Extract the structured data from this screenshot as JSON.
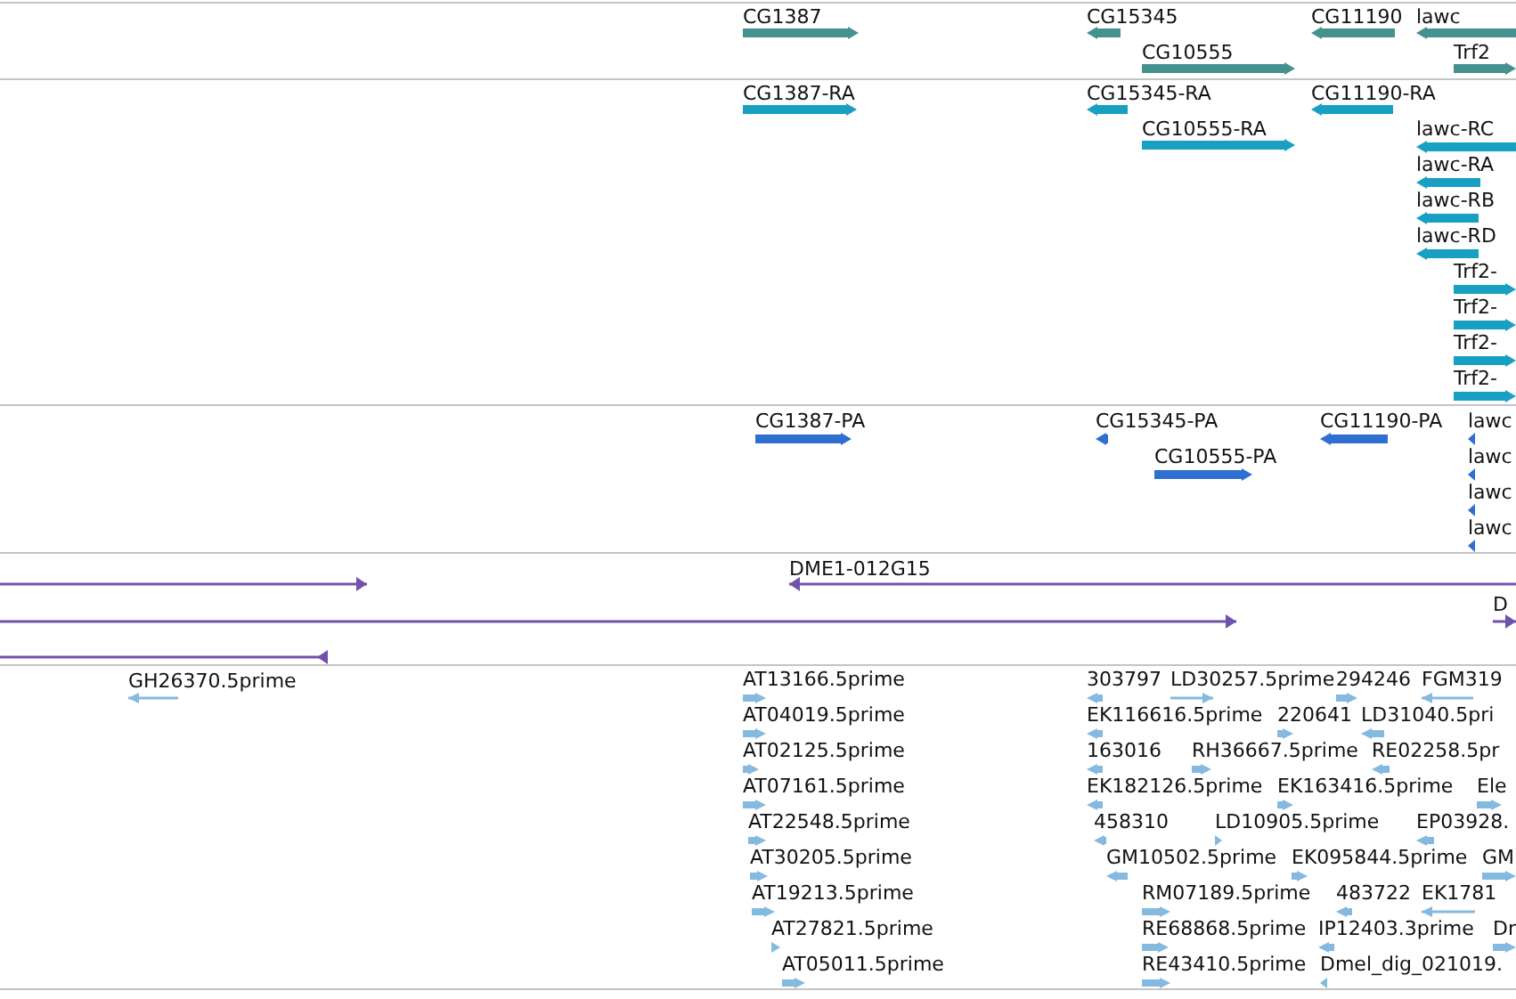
{
  "tracks": [
    {
      "kind": "gene",
      "features": [
        {
          "label": "CG1387",
          "reverse": false
        },
        {
          "label": "CG15345",
          "reverse": true
        },
        {
          "label": "CG10555",
          "reverse": false
        },
        {
          "label": "CG11190",
          "reverse": true
        },
        {
          "label": "lawc",
          "reverse": true
        },
        {
          "label": "Trf2",
          "reverse": false
        }
      ]
    },
    {
      "kind": "transcript",
      "features": [
        {
          "label": "CG1387-RA",
          "reverse": false
        },
        {
          "label": "CG15345-RA",
          "reverse": true
        },
        {
          "label": "CG11190-RA",
          "reverse": true
        },
        {
          "label": "CG10555-RA",
          "reverse": false
        },
        {
          "label": "lawc-RC",
          "reverse": true
        },
        {
          "label": "lawc-RA",
          "reverse": true
        },
        {
          "label": "lawc-RB",
          "reverse": true
        },
        {
          "label": "lawc-RD",
          "reverse": true
        },
        {
          "label": "Trf2-",
          "reverse": false
        },
        {
          "label": "Trf2-",
          "reverse": false
        },
        {
          "label": "Trf2-",
          "reverse": false
        },
        {
          "label": "Trf2-",
          "reverse": false
        }
      ]
    },
    {
      "kind": "protein",
      "features": [
        {
          "label": "CG1387-PA",
          "reverse": false
        },
        {
          "label": "CG15345-PA",
          "reverse": true
        },
        {
          "label": "CG11190-PA",
          "reverse": true
        },
        {
          "label": "lawc",
          "reverse": true
        },
        {
          "label": "CG10555-PA",
          "reverse": false
        },
        {
          "label": "lawc",
          "reverse": true
        },
        {
          "label": "lawc",
          "reverse": true
        },
        {
          "label": "lawc",
          "reverse": true
        }
      ]
    },
    {
      "kind": "clone",
      "features": [
        {
          "reverse": false
        },
        {
          "label": "DME1-012G15",
          "reverse": true
        },
        {
          "reverse": false
        },
        {
          "label": "D",
          "reverse": false
        },
        {
          "reverse": true
        }
      ]
    },
    {
      "kind": "est",
      "features": [
        {
          "label": "GH26370.5prime",
          "reverse": true
        },
        {
          "label": "AT13166.5prime",
          "reverse": false
        },
        {
          "label": "303797",
          "reverse": true
        },
        {
          "label": "LD30257.5prime",
          "reverse": false
        },
        {
          "label": "294246",
          "reverse": false
        },
        {
          "label": "FGM319",
          "reverse": true
        },
        {
          "label": "AT04019.5prime",
          "reverse": false
        },
        {
          "label": "EK116616.5prime",
          "reverse": true
        },
        {
          "label": "220641",
          "reverse": false
        },
        {
          "label": "LD31040.5pri",
          "reverse": true
        },
        {
          "label": "AT02125.5prime",
          "reverse": false
        },
        {
          "label": "163016",
          "reverse": true
        },
        {
          "label": "RH36667.5prime",
          "reverse": false
        },
        {
          "label": "RE02258.5pr",
          "reverse": true
        },
        {
          "label": "AT07161.5prime",
          "reverse": false
        },
        {
          "label": "EK182126.5prime",
          "reverse": true
        },
        {
          "label": "EK163416.5prime",
          "reverse": false
        },
        {
          "label": "Ele",
          "reverse": false
        },
        {
          "label": "AT22548.5prime",
          "reverse": false
        },
        {
          "label": "458310",
          "reverse": true
        },
        {
          "label": "LD10905.5prime",
          "reverse": false
        },
        {
          "label": "EP03928.",
          "reverse": true
        },
        {
          "label": "AT30205.5prime",
          "reverse": false
        },
        {
          "label": "GM10502.5prime",
          "reverse": true
        },
        {
          "label": "EK095844.5prime",
          "reverse": false
        },
        {
          "label": "GM",
          "reverse": false
        },
        {
          "label": "AT19213.5prime",
          "reverse": false
        },
        {
          "label": "RM07189.5prime",
          "reverse": false
        },
        {
          "label": "483722",
          "reverse": true
        },
        {
          "label": "EK1781",
          "reverse": true
        },
        {
          "label": "AT27821.5prime",
          "reverse": false
        },
        {
          "label": "RE68868.5prime",
          "reverse": false
        },
        {
          "label": "IP12403.3prime",
          "reverse": true
        },
        {
          "label": "Dr",
          "reverse": false
        },
        {
          "label": "AT05011.5prime",
          "reverse": false
        },
        {
          "label": "RE43410.5prime",
          "reverse": false
        },
        {
          "label": "Dmel_dig_021019.",
          "reverse": true
        }
      ]
    }
  ]
}
